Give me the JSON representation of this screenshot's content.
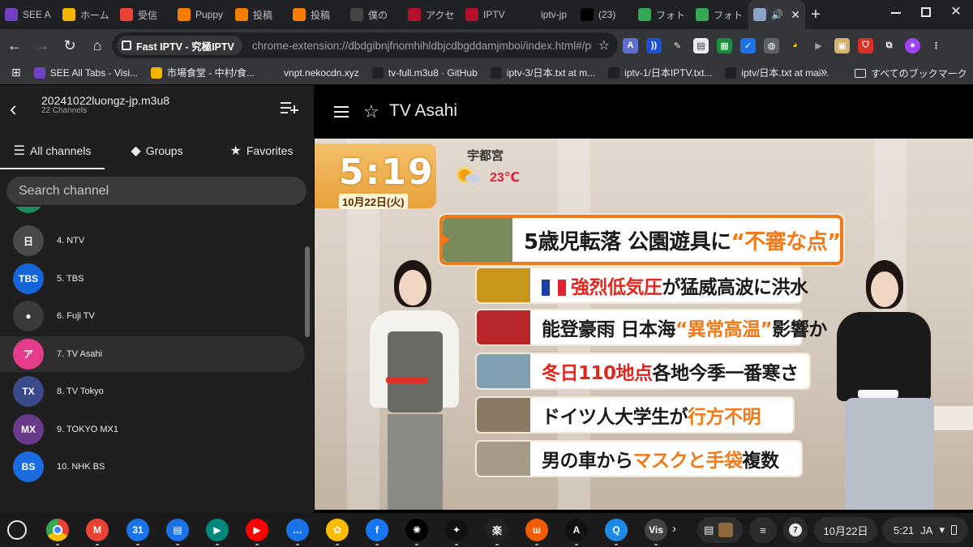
{
  "browser": {
    "tabs": [
      {
        "label": "SEE A",
        "icon": "vision-icon",
        "color": "#6f42c1"
      },
      {
        "label": "ホーム",
        "icon": "drive-icon",
        "color": "#f4b400"
      },
      {
        "label": "受信",
        "icon": "gmail-icon",
        "color": "#ea4335"
      },
      {
        "label": "Puppy",
        "icon": "blogger-icon",
        "color": "#f57d00"
      },
      {
        "label": "投稿",
        "icon": "blogger-icon",
        "color": "#f57d00"
      },
      {
        "label": "投稿",
        "icon": "blogger-icon",
        "color": "#f57d00"
      },
      {
        "label": "僕の",
        "icon": "circle-info-icon",
        "color": "#444444"
      },
      {
        "label": "アクセ",
        "icon": "circle-info-icon",
        "color": "#b3122a"
      },
      {
        "label": "IPTV",
        "icon": "circle-info-icon",
        "color": "#b3122a"
      },
      {
        "label": "iptv-jp",
        "icon": "github-icon",
        "color": "#202124"
      },
      {
        "label": "(23)",
        "icon": "x-icon",
        "color": "#000000"
      },
      {
        "label": "フォト",
        "icon": "photos-icon",
        "color": "#34a853"
      },
      {
        "label": "フォト",
        "icon": "photos-icon",
        "color": "#34a853"
      }
    ],
    "active_tab_close": "✕",
    "new_tab": "+",
    "site_chip": "Fast IPTV - 究極IPTV",
    "url": "chrome-extension://dbdgibnjfnomhihldbjcdbgddamjmboi/index.html#/playlists...",
    "bookmarks": [
      {
        "label": "SEE All Tabs - Visi...",
        "color": "#6f42c1"
      },
      {
        "label": "市場食堂 - 中村/食...",
        "color": "#f4b400"
      },
      {
        "label": "vnpt.nekocdn.xyz",
        "color": "#35363a"
      },
      {
        "label": "tv-full.m3u8 · GitHub",
        "color": "#202124"
      },
      {
        "label": "iptv-3/日本.txt at m...",
        "color": "#202124"
      },
      {
        "label": "iptv-1/日本IPTV.txt...",
        "color": "#202124"
      },
      {
        "label": "iptv/日本.txt at mai...",
        "color": "#202124"
      }
    ],
    "all_bookmarks": "すべてのブックマーク",
    "bookmarks_more": "»"
  },
  "sidebar": {
    "back": "‹",
    "playlist_title": "20241022luongz-jp.m3u8",
    "playlist_count": "22 Channels",
    "tabs": [
      {
        "label": "All channels",
        "icon": "list-icon"
      },
      {
        "label": "Groups",
        "icon": "shapes-icon"
      },
      {
        "label": "Favorites",
        "icon": "star-icon"
      }
    ],
    "search_placeholder": "Search channel",
    "channels": [
      {
        "name": "4. NTV",
        "logo_bg": "#4a4a4a",
        "logo_text": "日"
      },
      {
        "name": "5. TBS",
        "logo_bg": "#1565d8",
        "logo_text": "TBS"
      },
      {
        "name": "6. Fuji TV",
        "logo_bg": "#3a3a3a",
        "logo_text": "●"
      },
      {
        "name": "7. TV Asahi",
        "logo_bg": "#e63c8c",
        "logo_text": "ア"
      },
      {
        "name": "8. TV Tokyo",
        "logo_bg": "#3b4a8a",
        "logo_text": "TX"
      },
      {
        "name": "9. TOKYO MX1",
        "logo_bg": "#6a3a8a",
        "logo_text": "MX"
      },
      {
        "name": "10. NHK BS",
        "logo_bg": "#1a6be0",
        "logo_text": "BS"
      }
    ],
    "selected_channel": "7. TV Asahi"
  },
  "player": {
    "title": "TV Asahi",
    "clock_time": "5:19",
    "clock_date": "10月22日(火)",
    "weather_city": "宇都宮",
    "weather_temp": "23℃",
    "headlines": [
      {
        "pre": "5歳児転落 公園遊具に",
        "hi": "“不審な点”",
        "post": "",
        "thumb": "#7b8a5a"
      },
      {
        "pre": "",
        "hi": "強烈低気圧",
        "post": "が猛威高波に洪水",
        "thumb": "#c8961a"
      },
      {
        "pre": "能登豪雨 日本海",
        "hi": "“異常高温”",
        "post": "影響か",
        "thumb": "#b8262a"
      },
      {
        "pre": "",
        "hi": "冬日110地点",
        "post": "各地今季一番寒さ",
        "thumb": "#7fa0b0"
      },
      {
        "pre": "ドイツ人大学生が",
        "hi": "行方不明",
        "post": "",
        "thumb": "#8a7a64"
      },
      {
        "pre": "男の車から",
        "hi": "マスクと手袋",
        "post": "複数",
        "thumb": "#a89a88"
      }
    ]
  },
  "shelf": {
    "apps": [
      {
        "name": "chrome-icon",
        "color": "#4285f4",
        "label": ""
      },
      {
        "name": "gmail-icon",
        "color": "#ea4335",
        "label": "M"
      },
      {
        "name": "calendar-icon",
        "color": "#1a73e8",
        "label": "31"
      },
      {
        "name": "files-icon",
        "color": "#1a73e8",
        "label": "▤"
      },
      {
        "name": "meet-icon",
        "color": "#00897b",
        "label": "▶"
      },
      {
        "name": "youtube-icon",
        "color": "#ff0000",
        "label": "▶"
      },
      {
        "name": "messages-icon",
        "color": "#1a73e8",
        "label": "…"
      },
      {
        "name": "photos-icon",
        "color": "#fbbc04",
        "label": "✿"
      },
      {
        "name": "facebook-icon",
        "color": "#1877f2",
        "label": "f"
      },
      {
        "name": "openai-icon",
        "color": "#000000",
        "label": "✺"
      },
      {
        "name": "sparkle-app-icon",
        "color": "#111111",
        "label": "✦"
      },
      {
        "name": "kanji-app-icon",
        "color": "#222222",
        "label": "楽"
      },
      {
        "name": "orange-app-icon",
        "color": "#f25c05",
        "label": "ш"
      },
      {
        "name": "anthropic-icon",
        "color": "#111111",
        "label": "A"
      },
      {
        "name": "search-app-icon",
        "color": "#1e88e5",
        "label": "Q"
      },
      {
        "name": "vision-app-icon",
        "color": "#444444",
        "label": "Vis"
      }
    ],
    "more": "›",
    "notification_count": "7",
    "date": "10月22日",
    "time": "5:21",
    "ime": "JA"
  }
}
